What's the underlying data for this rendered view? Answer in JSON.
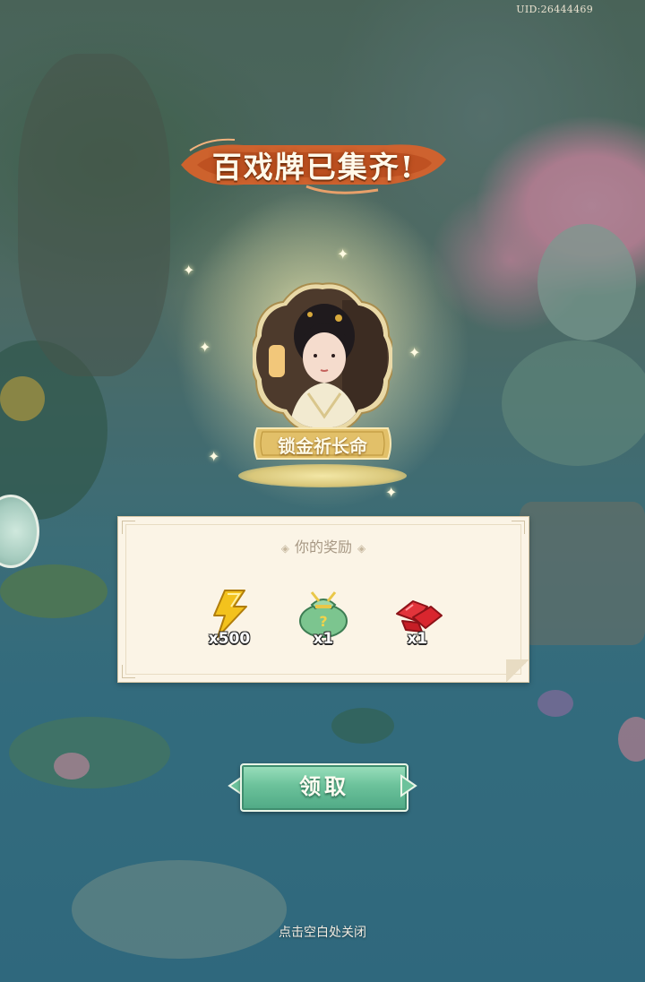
{
  "header": {
    "uid": "UID:26444469"
  },
  "banner": {
    "title": "百戏牌已集齐!"
  },
  "card": {
    "name": "锁金祈长命"
  },
  "rewards_panel": {
    "title": "你的奖励",
    "items": [
      {
        "icon": "lightning-energy-icon",
        "quantity": "x500",
        "color": "#f3c21d"
      },
      {
        "icon": "mystery-bag-icon",
        "quantity": "x1",
        "color": "#7cc58f"
      },
      {
        "icon": "red-gem-icon",
        "quantity": "x1",
        "color": "#d9262e"
      }
    ]
  },
  "actions": {
    "claim_label": "领取",
    "close_hint": "点击空白处关闭"
  },
  "colors": {
    "claim_button": "#6cc29b",
    "panel_bg": "#fbf4e6",
    "banner": "#d9622a"
  }
}
